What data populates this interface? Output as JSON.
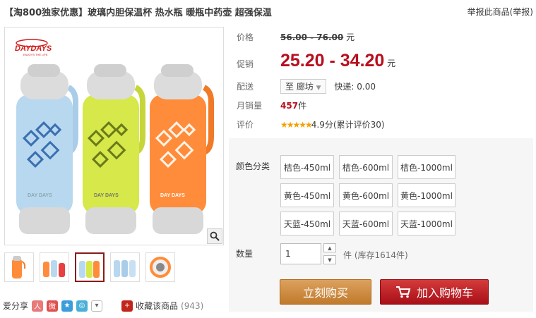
{
  "header": {
    "title": "【淘800独家优惠】玻璃内胆保温杯 热水瓶 暖瓶中药壶 超强保温",
    "report": "举报此商品(举报)"
  },
  "gallery": {
    "brand": "DAYDAYS",
    "brand_tagline": "ENJOYS THE LIFE",
    "bottle_text": "DAY DAYS",
    "colors": {
      "blue": "#b8d8f0",
      "yellow": "#d6e84a",
      "orange": "#ff8c3a",
      "cap": "#d8d8d8",
      "brand_red": "#d01a1a"
    }
  },
  "share": {
    "label": "爱分享",
    "fav_label": "收藏该商品",
    "fav_count": "(943)"
  },
  "price": {
    "label": "价格",
    "original": "56.00 - 76.00",
    "unit": "元",
    "promo_label": "促销",
    "promo": "25.20 - 34.20",
    "promo_unit": "元"
  },
  "delivery": {
    "label": "配送",
    "to": "至 廊坊",
    "express": "快递: 0.00"
  },
  "sales": {
    "label": "月销量",
    "count": "457",
    "unit": "件"
  },
  "rating": {
    "label": "评价",
    "stars": "★★★★★",
    "score": "4.9分",
    "reviews": "(累计评价30)"
  },
  "sku": {
    "label": "颜色分类",
    "options": [
      "桔色-450ml",
      "桔色-600ml",
      "桔色-1000ml",
      "黄色-450ml",
      "黄色-600ml",
      "黄色-1000ml",
      "天蓝-450ml",
      "天蓝-600ml",
      "天蓝-1000ml"
    ]
  },
  "quantity": {
    "label": "数量",
    "value": "1",
    "note": "件 (库存1614件)"
  },
  "actions": {
    "buy": "立刻购买",
    "cart": "加入购物车"
  },
  "accent": {
    "price_red": "#b80f1e",
    "buy_orange": "#c98838",
    "cart_red": "#b81820"
  }
}
